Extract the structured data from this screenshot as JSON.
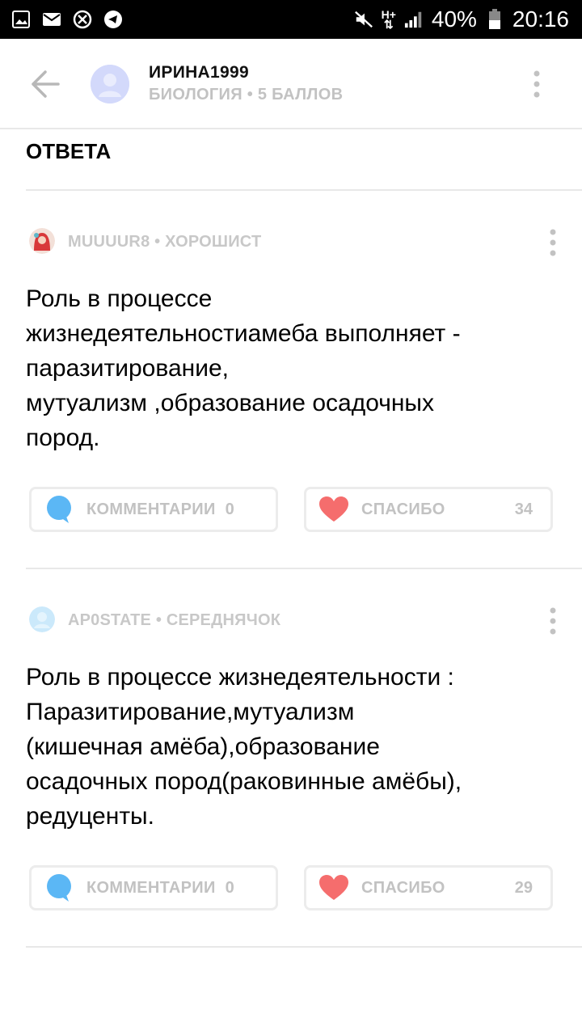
{
  "status_bar": {
    "left_icons": [
      "gallery-icon",
      "mail-icon",
      "missed-call-icon",
      "telegram-icon"
    ],
    "right_icons": [
      "mute-icon",
      "network-icon",
      "signal-icon",
      "battery-icon"
    ],
    "network_type": "H+",
    "battery": "40%",
    "time": "20:16"
  },
  "header": {
    "username": "ИРИНА1999",
    "subtitle": "БИОЛОГИЯ • 5 БАЛЛОВ"
  },
  "section": {
    "title": "ОТВЕТА"
  },
  "answers": [
    {
      "author": "MUUUUR8",
      "rank": "ХОРОШИСТ",
      "text": "Роль в процессе\nжизнедеятельностиамеба выполняет -\nпаразитирование,\nмутуализм ,образование осадочных\nпород.",
      "comments_label": "КОММЕНТАРИИ",
      "comments_count": "0",
      "thanks_label": "СПАСИБО",
      "thanks_count": "34"
    },
    {
      "author": "AP0STATE",
      "rank": "СЕРЕДНЯЧОК",
      "text": "Роль в процессе жизнедеятельности :\nПаразитирование,мутуализм\n(кишечная амёба),образование\nосадочных пород(раковинные амёбы),\nредуценты.",
      "comments_label": "КОММЕНТАРИИ",
      "comments_count": "0",
      "thanks_label": "СПАСИБО",
      "thanks_count": "29"
    }
  ],
  "colors": {
    "comment_icon": "#5bb7f5",
    "heart_icon": "#f56d6d",
    "muted_text": "#c2c2c2",
    "divider": "#e8e8e8"
  }
}
